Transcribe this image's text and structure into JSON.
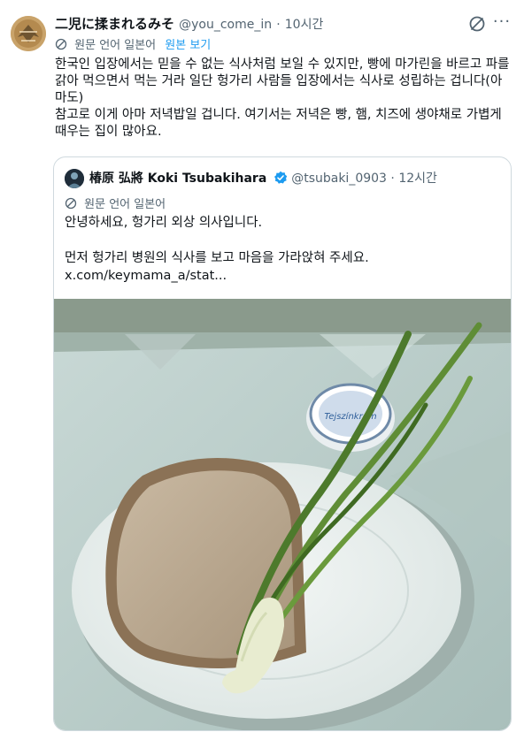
{
  "post": {
    "author_name": "二児に揉まれるみそ",
    "handle": "@you_come_in",
    "separator": "·",
    "time": "10시간",
    "translate_note": "원문 언어 일본어",
    "view_original": "원본 보기",
    "body": "한국인 입장에서는 믿을 수 없는 식사처럼 보일 수 있지만, 빵에 마가린을 바르고 파를\n갉아 먹으면서 먹는 거라 일단 헝가리 사람들 입장에서는 식사로 성립하는 겁니다(아\n마도)\n참고로 이게 아마 저녁밥일 겁니다. 여기서는 저녁은 빵, 햄, 치즈에 생야채로 가볍게\n때우는 집이 많아요.",
    "more_label": "···"
  },
  "quote": {
    "author_name": "椿原 弘將 Koki Tsubakihara",
    "handle": "@tsubaki_0903",
    "separator": "·",
    "time": "12시간",
    "translate_note": "원문 언어 일본어",
    "body": "안녕하세요, 헝가리 외상 의사입니다.\n\n먼저 헝가리 병원의 식사를 보고 마음을 가라앉혀 주세요.\nx.com/keymama_a/stat...",
    "image_text": "Tejszínkrém"
  },
  "colors": {
    "accent": "#1d9bf0",
    "muted": "#536471",
    "border": "#cfd9de"
  },
  "icons": [
    "grok-icon",
    "more-icon",
    "translate-icon",
    "verified-badge-icon"
  ]
}
